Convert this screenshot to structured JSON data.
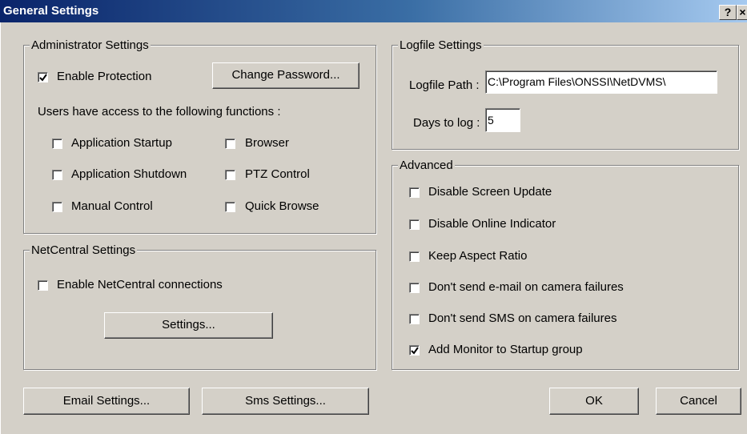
{
  "window": {
    "title": "General Settings",
    "help_label": "?",
    "close_label": "×"
  },
  "admin": {
    "legend": "Administrator Settings",
    "enable_protection": {
      "label": "Enable Protection",
      "checked": true
    },
    "change_password_label": "Change Password...",
    "access_text": "Users have access to the following functions :",
    "functions": [
      {
        "label": "Application Startup",
        "checked": false
      },
      {
        "label": "Browser",
        "checked": false
      },
      {
        "label": "Application Shutdown",
        "checked": false
      },
      {
        "label": "PTZ Control",
        "checked": false
      },
      {
        "label": "Manual Control",
        "checked": false
      },
      {
        "label": "Quick Browse",
        "checked": false
      }
    ]
  },
  "netcentral": {
    "legend": "NetCentral Settings",
    "enable": {
      "label": "Enable NetCentral connections",
      "checked": false
    },
    "settings_label": "Settings..."
  },
  "logfile": {
    "legend": "Logfile Settings",
    "path_label": "Logfile Path :",
    "path_value": "C:\\Program Files\\ONSSI\\NetDVMS\\",
    "days_label": "Days to log :",
    "days_value": "5"
  },
  "advanced": {
    "legend": "Advanced",
    "options": [
      {
        "label": "Disable Screen Update",
        "checked": false
      },
      {
        "label": "Disable Online Indicator",
        "checked": false
      },
      {
        "label": "Keep Aspect Ratio",
        "checked": false
      },
      {
        "label": "Don't send e-mail on camera failures",
        "checked": false
      },
      {
        "label": "Don't send SMS on camera failures",
        "checked": false
      },
      {
        "label": "Add Monitor to Startup group",
        "checked": true
      }
    ]
  },
  "footer": {
    "email_label": "Email Settings...",
    "sms_label": "Sms Settings...",
    "ok_label": "OK",
    "cancel_label": "Cancel"
  }
}
